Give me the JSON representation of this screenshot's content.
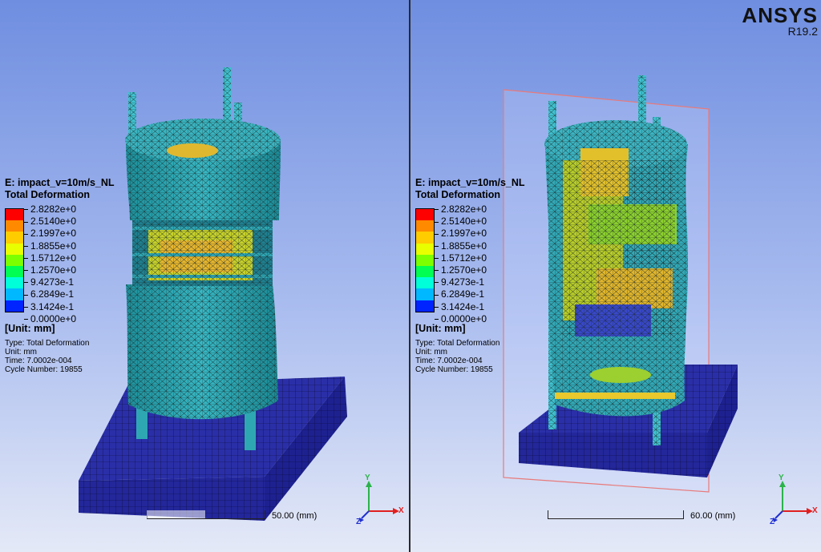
{
  "brand": {
    "name": "ANSYS",
    "version": "R19.2"
  },
  "colors": {
    "band_colors": [
      "#ff0000",
      "#ff8a00",
      "#ffcc00",
      "#e8ff00",
      "#7cff00",
      "#00ff52",
      "#00ffd9",
      "#00b8ff",
      "#0024ff"
    ]
  },
  "legend": {
    "title_line1": "E: impact_v=10m/s_NL",
    "title_line2": "Total Deformation",
    "ticks": [
      "2.8282e+0",
      "2.5140e+0",
      "2.1997e+0",
      "1.8855e+0",
      "1.5712e+0",
      "1.2570e+0",
      "9.4273e-1",
      "6.2849e-1",
      "3.1424e-1",
      "0.0000e+0"
    ],
    "unit": "[Unit: mm]",
    "info": [
      "Type: Total Deformation",
      "Unit: mm",
      "Time: 7.0002e-004",
      "Cycle Number: 19855"
    ]
  },
  "left": {
    "scale_label": "50.00  (mm)"
  },
  "right": {
    "scale_label": "60.00  (mm)"
  },
  "axes": {
    "x": "X",
    "y": "Y",
    "z": "Z"
  }
}
